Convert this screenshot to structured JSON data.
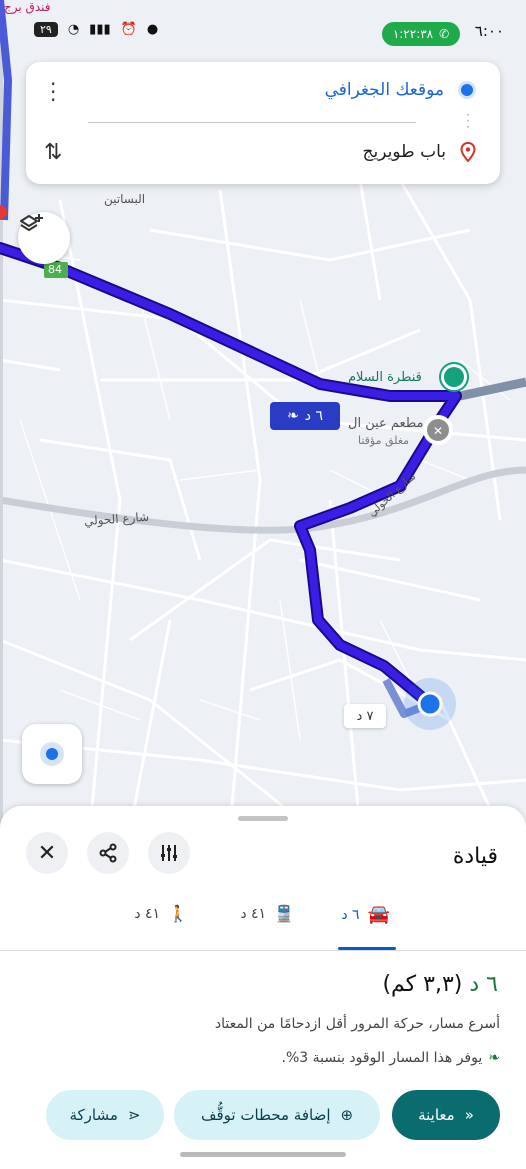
{
  "status_bar": {
    "time": "٦:٠٠",
    "call_timer": "١:٢٢:٣٨",
    "battery": "٢٩",
    "left_icons": [
      "location-icon",
      "alarm-icon",
      "signal-icon",
      "wifi-icon"
    ]
  },
  "search": {
    "origin": "موقعك الجغرافي",
    "destination": "باب طويريج"
  },
  "map": {
    "labels": {
      "top_left_place": "فندق برج",
      "area": "البساتين",
      "road_number": "84",
      "poi": "قنطرة السلام",
      "restaurant": "مطعم عين ال",
      "restaurant_status": "مغلق مؤقتا",
      "street_west": "شارع الحولي",
      "street_route": "شارع الحولي"
    },
    "route_badge": "٦ د",
    "alt_route_badge": "٧ د",
    "colors": {
      "route": "#2f16c8",
      "alt_route": "#7a8fd6",
      "accent": "#1a73e8"
    }
  },
  "sheet": {
    "title": "قيادة",
    "modes": [
      {
        "label": "٦ د",
        "icon": "car-icon",
        "active": true
      },
      {
        "label": "٤١ د",
        "icon": "train-icon",
        "active": false
      },
      {
        "label": "٤١ د",
        "icon": "walk-icon",
        "active": false
      }
    ],
    "duration": "٦ د",
    "distance": "(٣,٣ كم)",
    "description": "أسرع مسار، حركة المرور أقل ازدحامًا من المعتاد",
    "eco_note": "يوفر هذا المسار الوقود بنسبة 3%.",
    "actions": {
      "preview": "معاينة",
      "add_stops": "إضافة محطات توقُّف",
      "share": "مشاركة"
    }
  }
}
